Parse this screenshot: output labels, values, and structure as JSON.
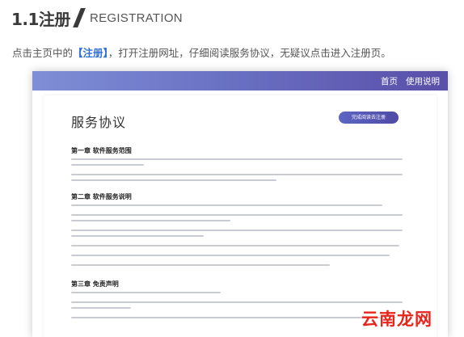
{
  "heading": {
    "number": "1.1注册",
    "english": "REGISTRATION"
  },
  "intro": {
    "before": "点击主页中的",
    "highlight": "【注册】",
    "after": "，打开注册网址，仔细阅读服务协议，无疑议点击进入注册页。"
  },
  "screenshot": {
    "nav": {
      "home": "首页",
      "help": "使用说明"
    },
    "page_title": "服务协议",
    "done_button": "完成阅读去注册",
    "chapters": [
      "第一章 软件服务范围",
      "第二章 软件服务说明",
      "第三章 免责声明"
    ]
  },
  "watermark": "云南龙网",
  "colors": {
    "accent": "#2f6fd6",
    "topbar_start": "#7f8ed6",
    "topbar_end": "#5a4fa8",
    "watermark": "#e8251d"
  }
}
